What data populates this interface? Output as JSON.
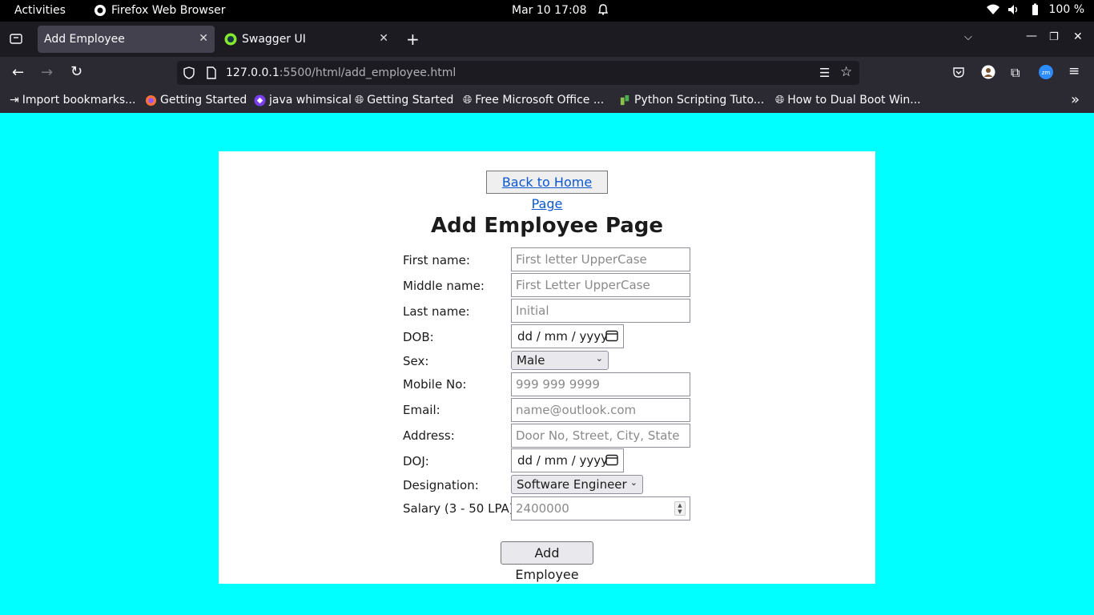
{
  "system": {
    "activities": "Activities",
    "app_name": "Firefox Web Browser",
    "datetime": "Mar 10  17:08",
    "battery": "100 %"
  },
  "browser": {
    "tabs": [
      {
        "title": "Add Employee"
      },
      {
        "title": "Swagger UI"
      }
    ],
    "url_host": "127.0.0.1",
    "url_path": ":5500/html/add_employee.html",
    "bookmarks": [
      "Import bookmarks...",
      "Getting Started",
      "java whimsical",
      "Getting Started",
      "Free Microsoft Office ...",
      "Python Scripting Tuto...",
      "How to Dual Boot Win..."
    ]
  },
  "page": {
    "back_link": "Back to Home Page",
    "title": "Add Employee Page",
    "labels": {
      "first_name": "First name:",
      "middle_name": "Middle name:",
      "last_name": "Last name:",
      "dob": "DOB:",
      "sex": "Sex:",
      "mobile": "Mobile No:",
      "email": "Email:",
      "address": "Address:",
      "doj": "DOJ:",
      "designation": "Designation:",
      "salary": "Salary (3 - 50 LPA):"
    },
    "placeholders": {
      "first_name": "First letter UpperCase",
      "middle_name": "First Letter UpperCase",
      "last_name": "Initial",
      "mobile": "999 999 9999",
      "email": "name@outlook.com",
      "address": "Door No, Street, City, State",
      "salary": "2400000"
    },
    "date_format": "dd / mm / yyyy",
    "sex_selected": "Male",
    "designation_selected": "Software Engineer",
    "submit": "Add Employee"
  },
  "colors": {
    "page_background": "#00ffff",
    "link": "#0b57d0"
  }
}
